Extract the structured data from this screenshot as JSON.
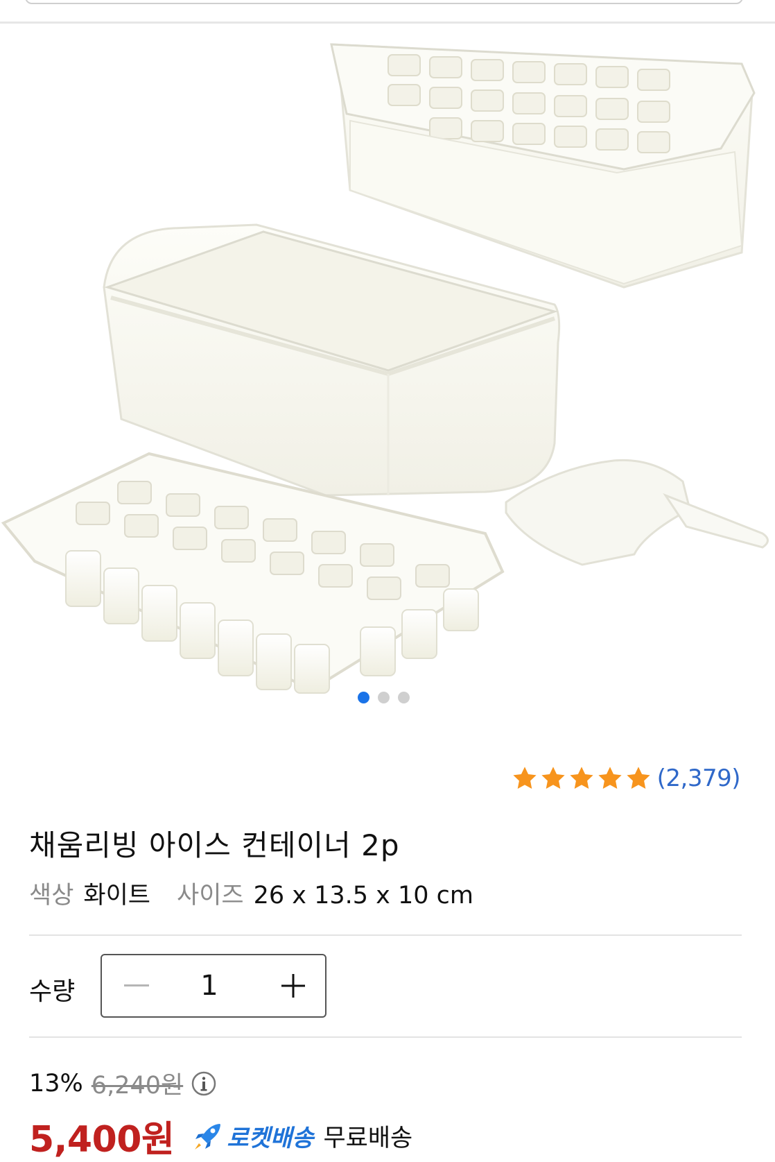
{
  "gallery": {
    "image_alt": "채움리빙 아이스 컨테이너 2p 제품 이미지",
    "slide_count": 3,
    "active_slide": 1
  },
  "colors": {
    "accent_blue": "#1a73e8",
    "review_blue": "#2f68c9",
    "star_orange": "#f7941d",
    "price_red": "#c0211f",
    "rocket_blue": "#1f73d8"
  },
  "rating": {
    "stars": 5,
    "review_count": "(2,379)"
  },
  "product": {
    "title": "채움리빙 아이스 컨테이너 2p",
    "specs": [
      {
        "label": "색상",
        "value": "화이트"
      },
      {
        "label": "사이즈",
        "value": "26 x 13.5 x 10 cm"
      }
    ]
  },
  "quantity": {
    "label": "수량",
    "value": "1",
    "minus_icon": "minus-icon",
    "plus_icon": "plus-icon"
  },
  "price": {
    "discount": "13%",
    "original": "6,240원",
    "final": "5,400원",
    "rocket_label": "로켓배송",
    "shipping": "무료배송",
    "info_icon": "info-icon",
    "rocket_icon": "rocket-icon"
  }
}
